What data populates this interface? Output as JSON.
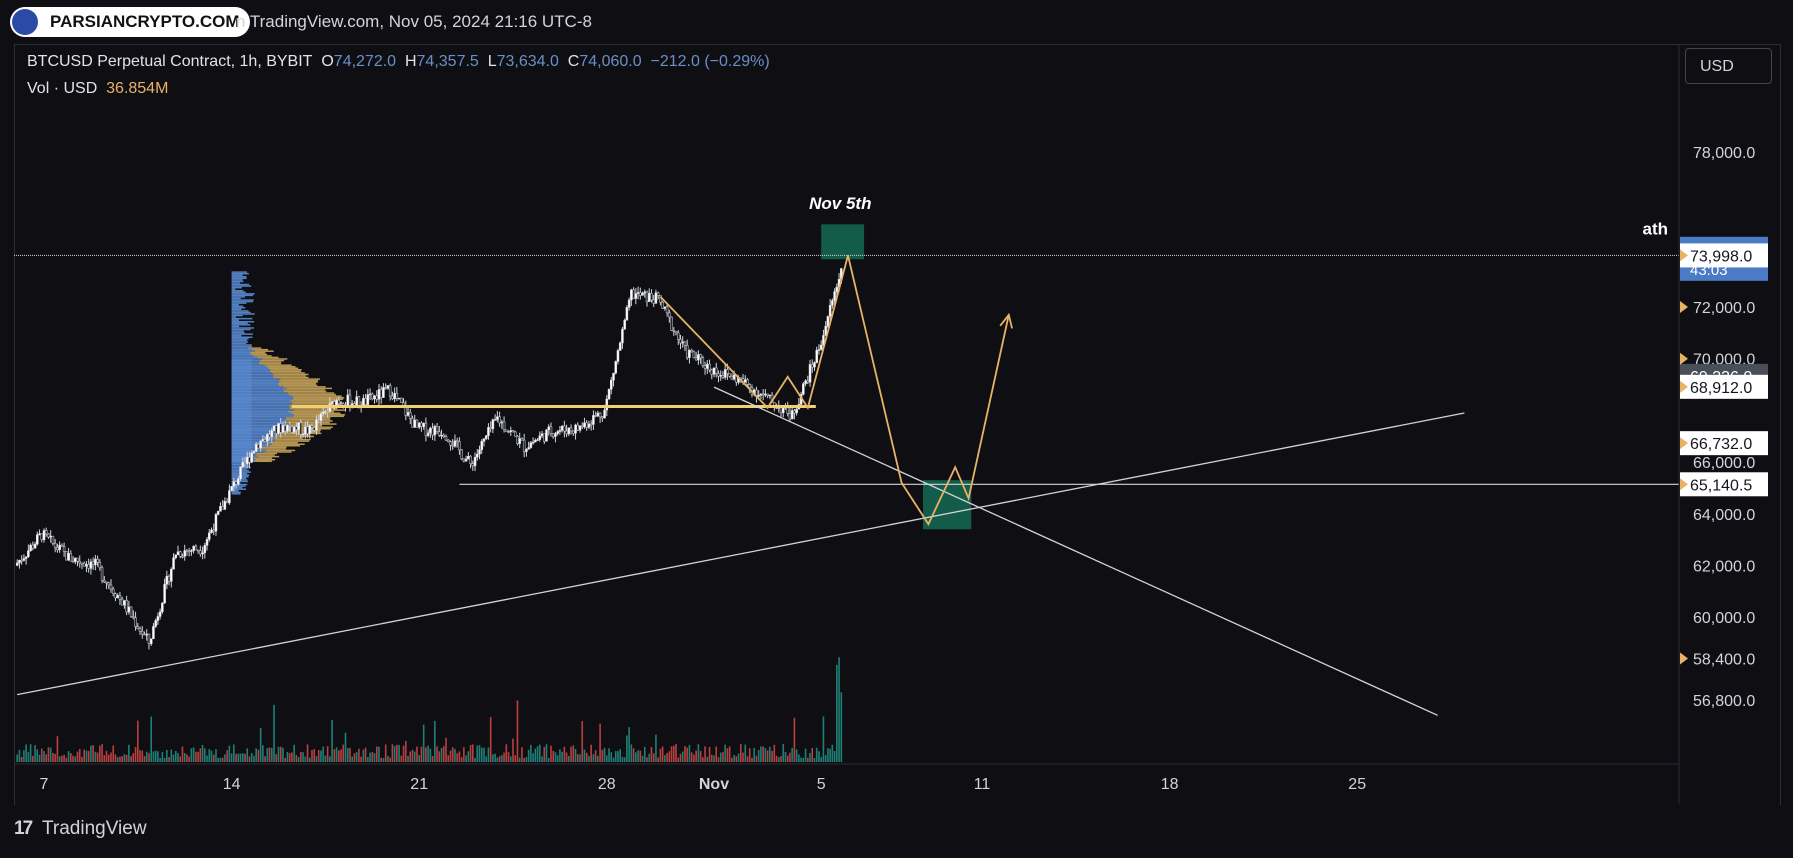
{
  "watermark": {
    "logo_text": "PARSIANCRYPTO.COM",
    "snapshot_text": "n TradingView.com, Nov 05, 2024 21:16 UTC-8"
  },
  "legend": {
    "symbol": "BTCUSD Perpetual Contract, 1h, BYBIT",
    "o_label": "O",
    "o_value": "74,272.0",
    "h_label": "H",
    "h_value": "74,357.5",
    "l_label": "L",
    "l_value": "73,634.0",
    "c_label": "C",
    "c_value": "74,060.0",
    "change": "−212.0 (−0.29%)",
    "vol_label": "Vol · USD",
    "vol_value": "36.854M"
  },
  "currency_button": "USD",
  "annotations": {
    "peak_label": "Nov 5th",
    "ath_label": "ath"
  },
  "colors": {
    "background": "#0f0f13",
    "up": "#26a69a",
    "down": "#ef5350",
    "poc": "#f2cf73",
    "projection": "#e8b266",
    "box": "#145c4a",
    "price_tag": "#4c7bc5",
    "profile_blue": "#5b8dd6",
    "profile_gold": "#c9a55c"
  },
  "footer": {
    "brand": "TradingView"
  },
  "chart_data": {
    "type": "candlestick",
    "symbol": "BTCUSD",
    "timeframe": "1h",
    "x_ticks": [
      "7",
      "14",
      "21",
      "28",
      "Nov",
      "5",
      "11",
      "18",
      "25"
    ],
    "y_ticks": [
      "78,000.0",
      "72,000.0",
      "70,000.0",
      "66,000.0",
      "64,000.0",
      "62,000.0",
      "60,000.0",
      "58,400.0",
      "56,800.0"
    ],
    "ylim": [
      55500,
      79500
    ],
    "price_path": [
      {
        "date": "Oct 6",
        "price": 62000
      },
      {
        "date": "Oct 7",
        "price": 63200
      },
      {
        "date": "Oct 8",
        "price": 62300
      },
      {
        "date": "Oct 9",
        "price": 62000
      },
      {
        "date": "Oct 10",
        "price": 60600
      },
      {
        "date": "Oct 11",
        "price": 59000
      },
      {
        "date": "Oct 12",
        "price": 62500
      },
      {
        "date": "Oct 13",
        "price": 62700
      },
      {
        "date": "Oct 14",
        "price": 64800
      },
      {
        "date": "Oct 15",
        "price": 66700
      },
      {
        "date": "Oct 16",
        "price": 67400
      },
      {
        "date": "Oct 17",
        "price": 67200
      },
      {
        "date": "Oct 18",
        "price": 68400
      },
      {
        "date": "Oct 19",
        "price": 68300
      },
      {
        "date": "Oct 20",
        "price": 68800
      },
      {
        "date": "Oct 21",
        "price": 67300
      },
      {
        "date": "Oct 22",
        "price": 67200
      },
      {
        "date": "Oct 23",
        "price": 65900
      },
      {
        "date": "Oct 24",
        "price": 67700
      },
      {
        "date": "Oct 25",
        "price": 66600
      },
      {
        "date": "Oct 26",
        "price": 67200
      },
      {
        "date": "Oct 27",
        "price": 67300
      },
      {
        "date": "Oct 28",
        "price": 68000
      },
      {
        "date": "Oct 29",
        "price": 72500
      },
      {
        "date": "Oct 30",
        "price": 72300
      },
      {
        "date": "Oct 31",
        "price": 70300
      },
      {
        "date": "Nov 1",
        "price": 69600
      },
      {
        "date": "Nov 2",
        "price": 69200
      },
      {
        "date": "Nov 3",
        "price": 68500
      },
      {
        "date": "Nov 4",
        "price": 67800
      },
      {
        "date": "Nov 5",
        "price": 70400
      },
      {
        "date": "Nov 6",
        "price": 74060
      }
    ],
    "price_labels": [
      {
        "price": 74060,
        "text": "74,060.0",
        "sub": "43:03",
        "style": "current"
      },
      {
        "price": 73998,
        "text": "73,998.0",
        "style": "white"
      },
      {
        "price": 69336,
        "text": "69,336.0",
        "style": "gray"
      },
      {
        "price": 68912,
        "text": "68,912.0",
        "style": "white"
      },
      {
        "price": 66732,
        "text": "66,732.0",
        "style": "white"
      },
      {
        "price": 65140.5,
        "text": "65,140.5",
        "style": "white"
      }
    ],
    "levels": [
      {
        "name": "ath",
        "price": 73998
      },
      {
        "name": "support",
        "price": 65140.5
      },
      {
        "name": "point-of-control",
        "price": 68150
      }
    ],
    "trendlines": [
      {
        "from": {
          "date": "Oct 6",
          "price": 57000
        },
        "to": {
          "date": "Nov 29",
          "price": 67900
        }
      },
      {
        "from": {
          "date": "Nov 1",
          "price": 68900
        },
        "to": {
          "date": "Nov 28",
          "price": 56200
        }
      }
    ],
    "projection": [
      {
        "date": "Oct 30",
        "price": 72400
      },
      {
        "date": "Nov 3",
        "price": 68100
      },
      {
        "date": "Nov 3.75",
        "price": 69300
      },
      {
        "date": "Nov 4.5",
        "price": 68100
      },
      {
        "date": "Nov 6",
        "price": 74000
      },
      {
        "date": "Nov 8",
        "price": 65200
      },
      {
        "date": "Nov 9",
        "price": 63600
      },
      {
        "date": "Nov 10",
        "price": 65800
      },
      {
        "date": "Nov 10.5",
        "price": 64600
      },
      {
        "date": "Nov 12",
        "price": 71700
      }
    ],
    "boxes": [
      {
        "from_date": "Nov 5",
        "to_date": "Nov 6.6",
        "high": 75200,
        "low": 73850
      },
      {
        "from_date": "Nov 8.8",
        "to_date": "Nov 10.6",
        "high": 65300,
        "low": 63400
      }
    ],
    "volume_profile": {
      "from_date": "Oct 14",
      "high": 73400,
      "low": 64800,
      "poc": 68150
    }
  }
}
